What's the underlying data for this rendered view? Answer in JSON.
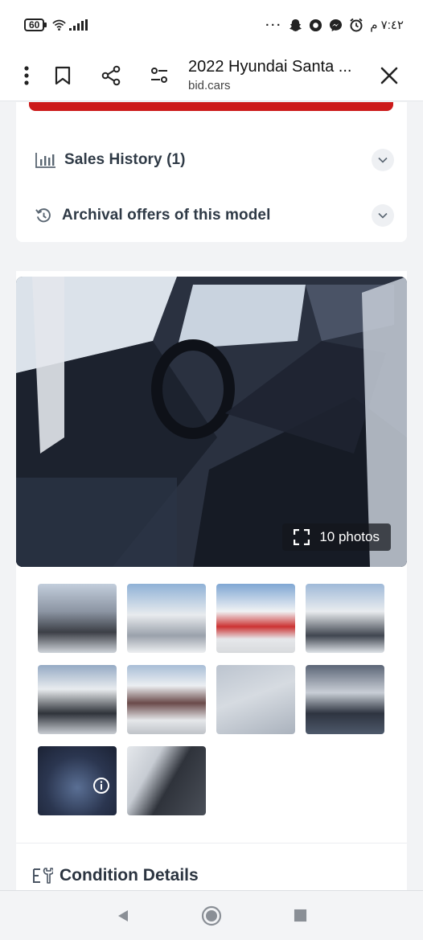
{
  "status_bar": {
    "battery": "60",
    "time": "٧:٤٢ م"
  },
  "toolbar": {
    "title": "2022 Hyundai Santa ...",
    "site": "bid.cars"
  },
  "sections": {
    "sales_history": "Sales History (1)",
    "archival_offers": "Archival offers of this model"
  },
  "gallery": {
    "photos_label": "10 photos",
    "thumbnail_count": 10
  },
  "condition": {
    "label": "Condition Details"
  },
  "colors": {
    "accent_red": "#cc1a1a",
    "text_dark": "#2f3a46",
    "chevron_bg": "#eef0f3"
  }
}
